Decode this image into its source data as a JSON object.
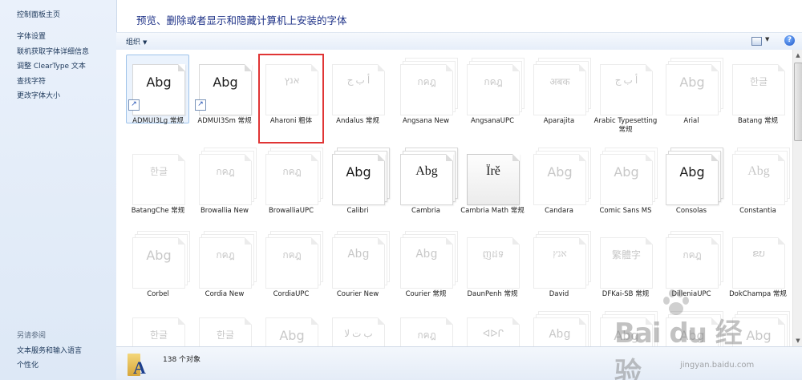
{
  "sidebar": {
    "home_link": "控制面板主页",
    "links": [
      "字体设置",
      "联机获取字体详细信息",
      "调整 ClearType 文本",
      "查找字符",
      "更改字体大小"
    ],
    "see_also_title": "另请参阅",
    "see_also_links": [
      "文本服务和输入语言",
      "个性化"
    ]
  },
  "header": {
    "title": "预览、删除或者显示和隐藏计算机上安装的字体"
  },
  "toolbar": {
    "organize_label": "组织",
    "help_label": "?"
  },
  "fonts": [
    {
      "name": "ADMUI3Lg 常规",
      "sample": "Abg",
      "style": "sans",
      "dim": false,
      "stack": false,
      "shortcut": true,
      "selected": true
    },
    {
      "name": "ADMUI3Sm 常规",
      "sample": "Abg",
      "style": "sans",
      "dim": false,
      "stack": false,
      "shortcut": true
    },
    {
      "name": "Aharoni 粗体",
      "sample": "אנץ",
      "style": "sans",
      "dim": true,
      "stack": false,
      "outlined": true
    },
    {
      "name": "Andalus 常规",
      "sample": "أ ب ج",
      "style": "serif",
      "dim": true,
      "stack": false
    },
    {
      "name": "Angsana New",
      "sample": "กคฎ",
      "style": "sans",
      "dim": true,
      "stack": true
    },
    {
      "name": "AngsanaUPC",
      "sample": "กคฎ",
      "style": "sans",
      "dim": true,
      "stack": true
    },
    {
      "name": "Aparajita",
      "sample": "अबक",
      "style": "sans",
      "dim": true,
      "stack": true
    },
    {
      "name": "Arabic Typesetting 常规",
      "sample": "أ ب ج",
      "style": "serif",
      "dim": true,
      "stack": false
    },
    {
      "name": "Arial",
      "sample": "Abg",
      "style": "sans",
      "dim": true,
      "stack": true
    },
    {
      "name": "Batang 常规",
      "sample": "한글",
      "style": "serif",
      "dim": true,
      "stack": false
    },
    {
      "name": "BatangChe 常规",
      "sample": "한글",
      "style": "serif",
      "dim": true,
      "stack": false
    },
    {
      "name": "Browallia New",
      "sample": "กคฎ",
      "style": "sans",
      "dim": true,
      "stack": true
    },
    {
      "name": "BrowalliaUPC",
      "sample": "กคฎ",
      "style": "sans",
      "dim": true,
      "stack": true
    },
    {
      "name": "Calibri",
      "sample": "Abg",
      "style": "sans",
      "dim": false,
      "stack": true
    },
    {
      "name": "Cambria",
      "sample": "Abg",
      "style": "serif",
      "dim": false,
      "stack": true
    },
    {
      "name": "Cambria Math 常规",
      "sample": "Ïrě",
      "style": "serif",
      "dim": false,
      "stack": false,
      "shaded": true
    },
    {
      "name": "Candara",
      "sample": "Abg",
      "style": "sans",
      "dim": true,
      "stack": true
    },
    {
      "name": "Comic Sans MS",
      "sample": "Abg",
      "style": "sans",
      "dim": true,
      "stack": true
    },
    {
      "name": "Consolas",
      "sample": "Abg",
      "style": "sans",
      "dim": false,
      "stack": true
    },
    {
      "name": "Constantia",
      "sample": "Abg",
      "style": "serif",
      "dim": true,
      "stack": true
    },
    {
      "name": "Corbel",
      "sample": "Abg",
      "style": "sans",
      "dim": true,
      "stack": true
    },
    {
      "name": "Cordia New",
      "sample": "กคฎ",
      "style": "sans",
      "dim": true,
      "stack": true
    },
    {
      "name": "CordiaUPC",
      "sample": "กคฎ",
      "style": "sans",
      "dim": true,
      "stack": true
    },
    {
      "name": "Courier New",
      "sample": "Abg",
      "style": "mono",
      "dim": true,
      "stack": true
    },
    {
      "name": "Courier 常规",
      "sample": "Abg",
      "style": "mono",
      "dim": true,
      "stack": true
    },
    {
      "name": "DaunPenh 常规",
      "sample": "ញដទ",
      "style": "sans",
      "dim": true,
      "stack": false
    },
    {
      "name": "David",
      "sample": "אנץ",
      "style": "serif",
      "dim": true,
      "stack": true
    },
    {
      "name": "DFKai-SB 常规",
      "sample": "繁體字",
      "style": "serif",
      "dim": true,
      "stack": false
    },
    {
      "name": "DilleniaUPC",
      "sample": "กคฎ",
      "style": "sans",
      "dim": true,
      "stack": true
    },
    {
      "name": "DokChampa 常规",
      "sample": "ຂບ",
      "style": "sans",
      "dim": true,
      "stack": false
    },
    {
      "name": "",
      "sample": "한글",
      "style": "serif",
      "dim": true,
      "stack": false
    },
    {
      "name": "",
      "sample": "한글",
      "style": "serif",
      "dim": true,
      "stack": false
    },
    {
      "name": "",
      "sample": "Abg",
      "style": "sans",
      "dim": true,
      "stack": false
    },
    {
      "name": "",
      "sample": "ب ت ﻻ",
      "style": "serif",
      "dim": true,
      "stack": false
    },
    {
      "name": "",
      "sample": "กคฎ",
      "style": "sans",
      "dim": true,
      "stack": false
    },
    {
      "name": "",
      "sample": "ᐊᐅᒋ",
      "style": "sans",
      "dim": true,
      "stack": false
    },
    {
      "name": "",
      "sample": "Abg",
      "style": "mono",
      "dim": true,
      "stack": true
    },
    {
      "name": "",
      "sample": "Abg",
      "style": "sans",
      "dim": true,
      "stack": true
    },
    {
      "name": "",
      "sample": "Abg",
      "style": "sans",
      "dim": true,
      "stack": true
    },
    {
      "name": "",
      "sample": "Abg",
      "style": "sans",
      "dim": true,
      "stack": true
    }
  ],
  "status": {
    "object_count": "138 个对象"
  },
  "watermark": {
    "brand": "Bai du 经验",
    "url": "jingyan.baidu.com"
  }
}
